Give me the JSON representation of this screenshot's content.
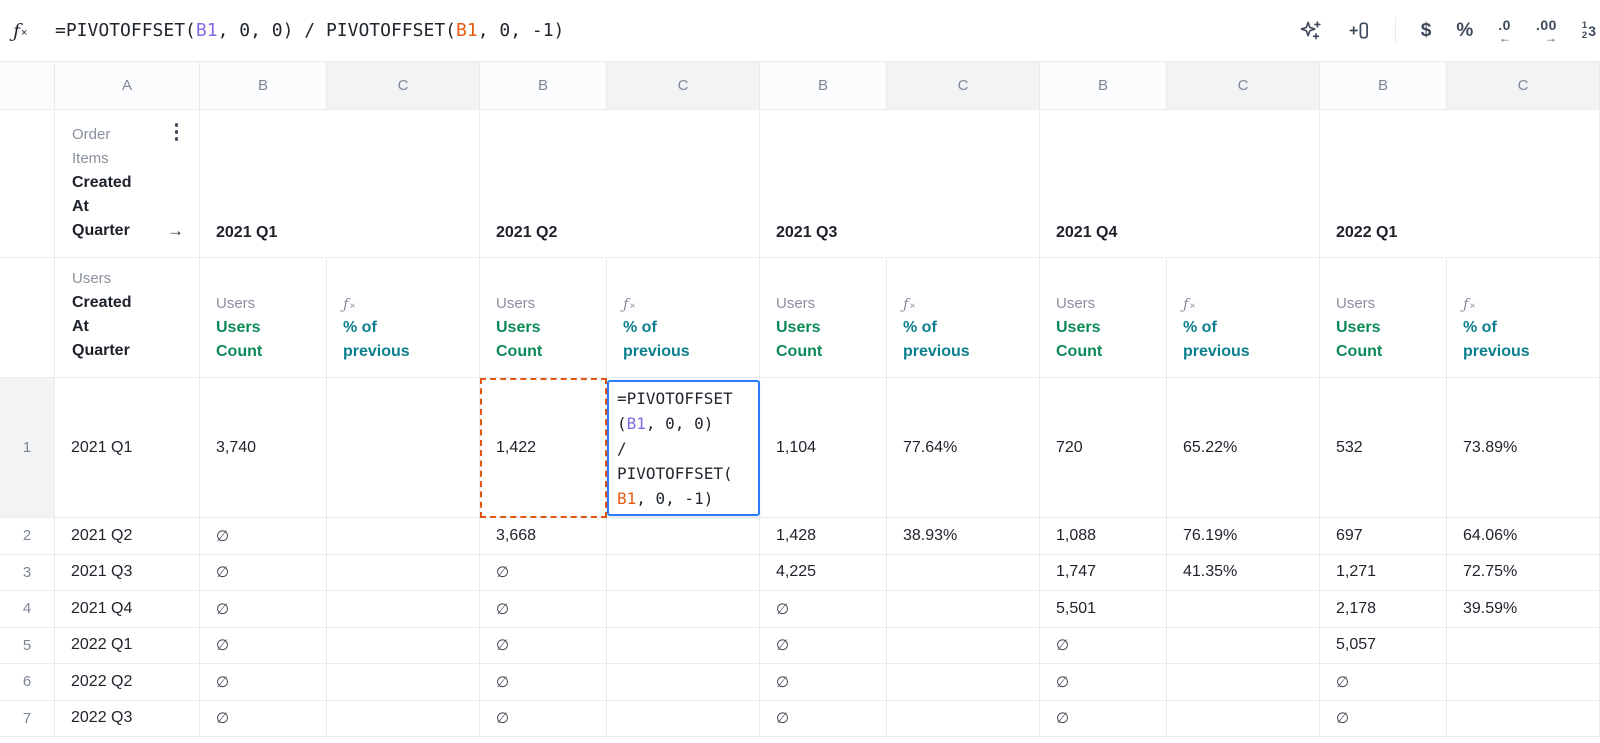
{
  "formula_bar": {
    "fx_glyph": "ƒ",
    "fx_sub_glyph": "×",
    "formula_segments": [
      {
        "text": "=PIVOTOFFSET(",
        "color": "default"
      },
      {
        "text": "B1",
        "color": "purple"
      },
      {
        "text": ", 0, 0) / PIVOTOFFSET(",
        "color": "default"
      },
      {
        "text": "B1",
        "color": "orange"
      },
      {
        "text": ", 0, -1)",
        "color": "default"
      }
    ]
  },
  "toolbar": {
    "ai_sparkle_icon": "sparkle-plus",
    "insert_cell_icon": "plus-frame",
    "currency_glyph": "$",
    "percent_glyph": "%",
    "decrease_decimal_glyph": ".0",
    "decrease_decimal_arrow": "←",
    "increase_decimal_glyph": ".00",
    "increase_decimal_arrow": "→",
    "number_format_stack": [
      "1",
      "2"
    ],
    "number_format_glyph": "3"
  },
  "columns": {
    "letters": [
      "",
      "A",
      "B",
      "C",
      "B",
      "C",
      "B",
      "C",
      "B",
      "C",
      "B",
      "C"
    ]
  },
  "pivot": {
    "column_dimension": {
      "table_lines": [
        "Order",
        "Items"
      ],
      "field_lines": [
        "Created",
        "At",
        "Quarter"
      ],
      "arrow": "→",
      "kebab_icon": "⋮"
    },
    "row_dimension": {
      "table_lines": [
        "Users"
      ],
      "field_lines": [
        "Created",
        "At",
        "Quarter"
      ]
    },
    "quarters": [
      "2021 Q1",
      "2021 Q2",
      "2021 Q3",
      "2021 Q4",
      "2022 Q1"
    ],
    "measure_count": {
      "table": "Users",
      "label_lines": [
        "Users",
        "Count"
      ]
    },
    "measure_formula": {
      "icon": "ƒ×",
      "label_lines": [
        "% of",
        "previous"
      ]
    }
  },
  "grid": {
    "empty_symbol": "∅",
    "rows": [
      {
        "num": "1",
        "label": "2021 Q1",
        "cells": [
          "3,740",
          "",
          "1,422",
          "",
          "1,104",
          "77.64%",
          "720",
          "65.22%",
          "532",
          "73.89%"
        ]
      },
      {
        "num": "2",
        "label": "2021 Q2",
        "cells": [
          "∅",
          "",
          "3,668",
          "",
          "1,428",
          "38.93%",
          "1,088",
          "76.19%",
          "697",
          "64.06%"
        ]
      },
      {
        "num": "3",
        "label": "2021 Q3",
        "cells": [
          "∅",
          "",
          "∅",
          "",
          "4,225",
          "",
          "1,747",
          "41.35%",
          "1,271",
          "72.75%"
        ]
      },
      {
        "num": "4",
        "label": "2021 Q4",
        "cells": [
          "∅",
          "",
          "∅",
          "",
          "∅",
          "",
          "5,501",
          "",
          "2,178",
          "39.59%"
        ]
      },
      {
        "num": "5",
        "label": "2022 Q1",
        "cells": [
          "∅",
          "",
          "∅",
          "",
          "∅",
          "",
          "∅",
          "",
          "5,057",
          ""
        ]
      },
      {
        "num": "6",
        "label": "2022 Q2",
        "cells": [
          "∅",
          "",
          "∅",
          "",
          "∅",
          "",
          "∅",
          "",
          "∅",
          ""
        ]
      },
      {
        "num": "7",
        "label": "2022 Q3",
        "cells": [
          "∅",
          "",
          "∅",
          "",
          "∅",
          "",
          "∅",
          "",
          "∅",
          ""
        ]
      }
    ]
  },
  "selection": {
    "formula_cell_lines": [
      [
        {
          "text": "=PIVOTOFFSET",
          "color": "default"
        }
      ],
      [
        {
          "text": "(",
          "color": "default"
        },
        {
          "text": "B1",
          "color": "purple"
        },
        {
          "text": ", 0, 0)",
          "color": "default"
        }
      ],
      [
        {
          "text": "/",
          "color": "default"
        }
      ],
      [
        {
          "text": "PIVOTOFFSET(",
          "color": "default"
        }
      ],
      [
        {
          "text": "B1",
          "color": "orange"
        },
        {
          "text": ", 0, -1)",
          "color": "default"
        }
      ]
    ]
  },
  "colors": {
    "selection_blue": "#2b7cf7",
    "reference_orange": "#e65c12",
    "reference_purple": "#8567e8",
    "measure_green": "#0e8a57",
    "formula_teal": "#0c7f8e",
    "grid_line": "#e9ebee",
    "header_shade": "#f1f3f5",
    "text_dark": "#1e222b",
    "text_gray": "#8a919e"
  }
}
